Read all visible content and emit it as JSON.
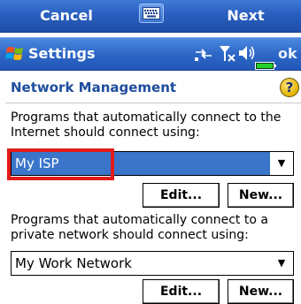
{
  "softkeys": {
    "left": "Cancel",
    "right": "Next"
  },
  "titlebar": {
    "title": "Settings",
    "ok_label": "ok"
  },
  "header": {
    "title": "Network Management",
    "help_glyph": "?"
  },
  "internet_section": {
    "description": "Programs that automatically connect to the Internet should connect using:",
    "selected": "My ISP",
    "edit_label": "Edit...",
    "new_label": "New..."
  },
  "private_section": {
    "description": "Programs that automatically connect to a private network should connect using:",
    "selected": "My Work Network",
    "edit_label": "Edit...",
    "new_label": "New..."
  },
  "colors": {
    "bar_blue": "#2a5fc0",
    "header_blue": "#1f4d9e",
    "selection_blue": "#3a75c9",
    "highlight_red": "#e21a1a"
  },
  "icons": [
    "keyboard-icon",
    "windows-start-icon",
    "connectivity-icon",
    "signal-icon",
    "volume-icon",
    "battery-icon",
    "help-icon",
    "dropdown-arrow-icon"
  ]
}
